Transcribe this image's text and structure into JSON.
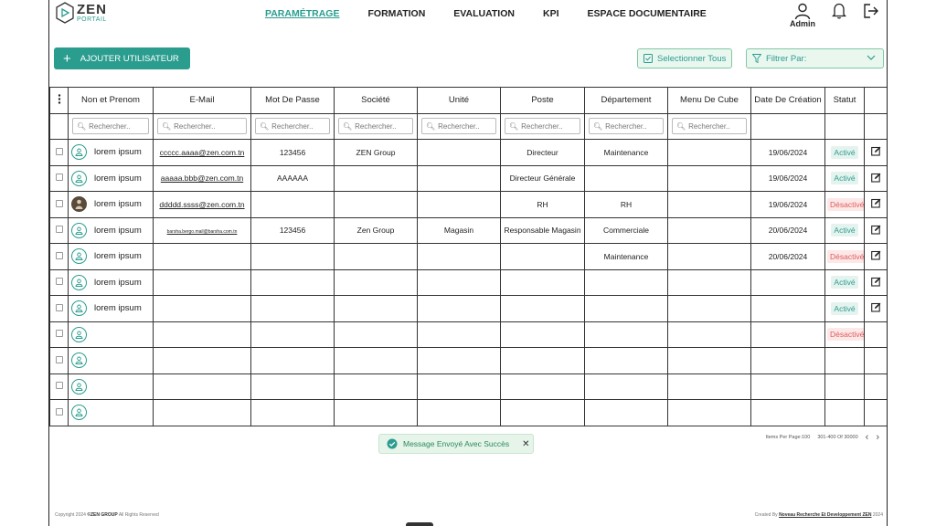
{
  "logo": {
    "title": "ZEN",
    "subtitle": "PORTAIL"
  },
  "nav": [
    {
      "label": "PARAMÉTRAGE",
      "active": true
    },
    {
      "label": "FORMATION",
      "active": false
    },
    {
      "label": "EVALUATION",
      "active": false
    },
    {
      "label": "KPI",
      "active": false
    },
    {
      "label": "ESPACE DOCUMENTAIRE",
      "active": false
    }
  ],
  "user": {
    "label": "Admin"
  },
  "actions": {
    "add_label": "AJOUTER UTILISATEUR",
    "select_all_label": "Selectionner Tous",
    "filter_label": "Filtrer Par:"
  },
  "table": {
    "columns": [
      "Non et Prenom",
      "E-Mail",
      "Mot De Passe",
      "Société",
      "Unité",
      "Poste",
      "Département",
      "Menu De Cube",
      "Date De Création",
      "Statut"
    ],
    "search_placeholder": "Rechercher..",
    "rows": [
      {
        "name": "lorem ipsum",
        "avatar": "user",
        "email": "ccccc.aaaa@zen.com.tn",
        "email_small": false,
        "password": "123456",
        "societe": "ZEN Group",
        "unite": "",
        "poste": "Directeur",
        "departement": "Maintenance",
        "menu": "",
        "date": "19/06/2024",
        "statut": "Activé",
        "active": true,
        "editable": true
      },
      {
        "name": "lorem ipsum",
        "avatar": "user",
        "email": "aaaaa.bbb@zen.com.tn",
        "email_small": false,
        "password": "AAAAAA",
        "societe": "",
        "unite": "",
        "poste": "Directeur Générale",
        "departement": "",
        "menu": "",
        "date": "19/06/2024",
        "statut": "Activé",
        "active": true,
        "editable": true
      },
      {
        "name": "lorem ipsum",
        "avatar": "photo",
        "email": "ddddd.ssss@zen.com.tn",
        "email_small": false,
        "password": "",
        "societe": "",
        "unite": "",
        "poste": "RH",
        "departement": "RH",
        "menu": "",
        "date": "19/06/2024",
        "statut": "Désactivé",
        "active": false,
        "editable": true
      },
      {
        "name": "lorem ipsum",
        "avatar": "user",
        "email": "barsha.bergo.mail@barsha.com.tn",
        "email_small": true,
        "password": "123456",
        "societe": "Zen Group",
        "unite": "Magasin",
        "poste": "Responsable Magasin",
        "departement": "Commerciale",
        "menu": "",
        "date": "20/06/2024",
        "statut": "Activé",
        "active": true,
        "editable": true
      },
      {
        "name": "lorem ipsum",
        "avatar": "user",
        "email": "",
        "email_small": false,
        "password": "",
        "societe": "",
        "unite": "",
        "poste": "",
        "departement": "Maintenance",
        "menu": "",
        "date": "20/06/2024",
        "statut": "Désactivé",
        "active": false,
        "editable": true
      },
      {
        "name": "lorem ipsum",
        "avatar": "user",
        "email": "",
        "email_small": false,
        "password": "",
        "societe": "",
        "unite": "",
        "poste": "",
        "departement": "",
        "menu": "",
        "date": "",
        "statut": "Activé",
        "active": true,
        "editable": true
      },
      {
        "name": "lorem ipsum",
        "avatar": "user",
        "email": "",
        "email_small": false,
        "password": "",
        "societe": "",
        "unite": "",
        "poste": "",
        "departement": "",
        "menu": "",
        "date": "",
        "statut": "Activé",
        "active": true,
        "editable": true
      },
      {
        "name": "",
        "avatar": "user",
        "email": "",
        "email_small": false,
        "password": "",
        "societe": "",
        "unite": "",
        "poste": "",
        "departement": "",
        "menu": "",
        "date": "",
        "statut": "Désactivé",
        "active": false,
        "editable": false
      },
      {
        "name": "",
        "avatar": "user",
        "email": "",
        "email_small": false,
        "password": "",
        "societe": "",
        "unite": "",
        "poste": "",
        "departement": "",
        "menu": "",
        "date": "",
        "statut": "",
        "active": true,
        "editable": false
      },
      {
        "name": "",
        "avatar": "user",
        "email": "",
        "email_small": false,
        "password": "",
        "societe": "",
        "unite": "",
        "poste": "",
        "departement": "",
        "menu": "",
        "date": "",
        "statut": "",
        "active": true,
        "editable": false
      },
      {
        "name": "",
        "avatar": "user",
        "email": "",
        "email_small": false,
        "password": "",
        "societe": "",
        "unite": "",
        "poste": "",
        "departement": "",
        "menu": "",
        "date": "",
        "statut": "",
        "active": true,
        "editable": false
      }
    ]
  },
  "pagination": {
    "items_per_page": "Items Per Page:100",
    "range": "301-400 Of 30000",
    "prev": "‹",
    "next": "›"
  },
  "toast": {
    "message": "Message Envoyé Avec Succès",
    "close": "✕"
  },
  "footer": {
    "left_prefix": "Copyright 2024 ",
    "left_brand": "©ZEN GROUP",
    "left_suffix": " All Rights Reserved",
    "right_prefix": "Created By ",
    "right_brand": "Noveau Recherche Et Developpement ZEN",
    "right_suffix": " 2024"
  },
  "colors": {
    "accent": "#2a9d8f",
    "active_bg": "#e5f3ef",
    "inactive_fg": "#e05a5a",
    "inactive_bg": "#fde8e8"
  }
}
